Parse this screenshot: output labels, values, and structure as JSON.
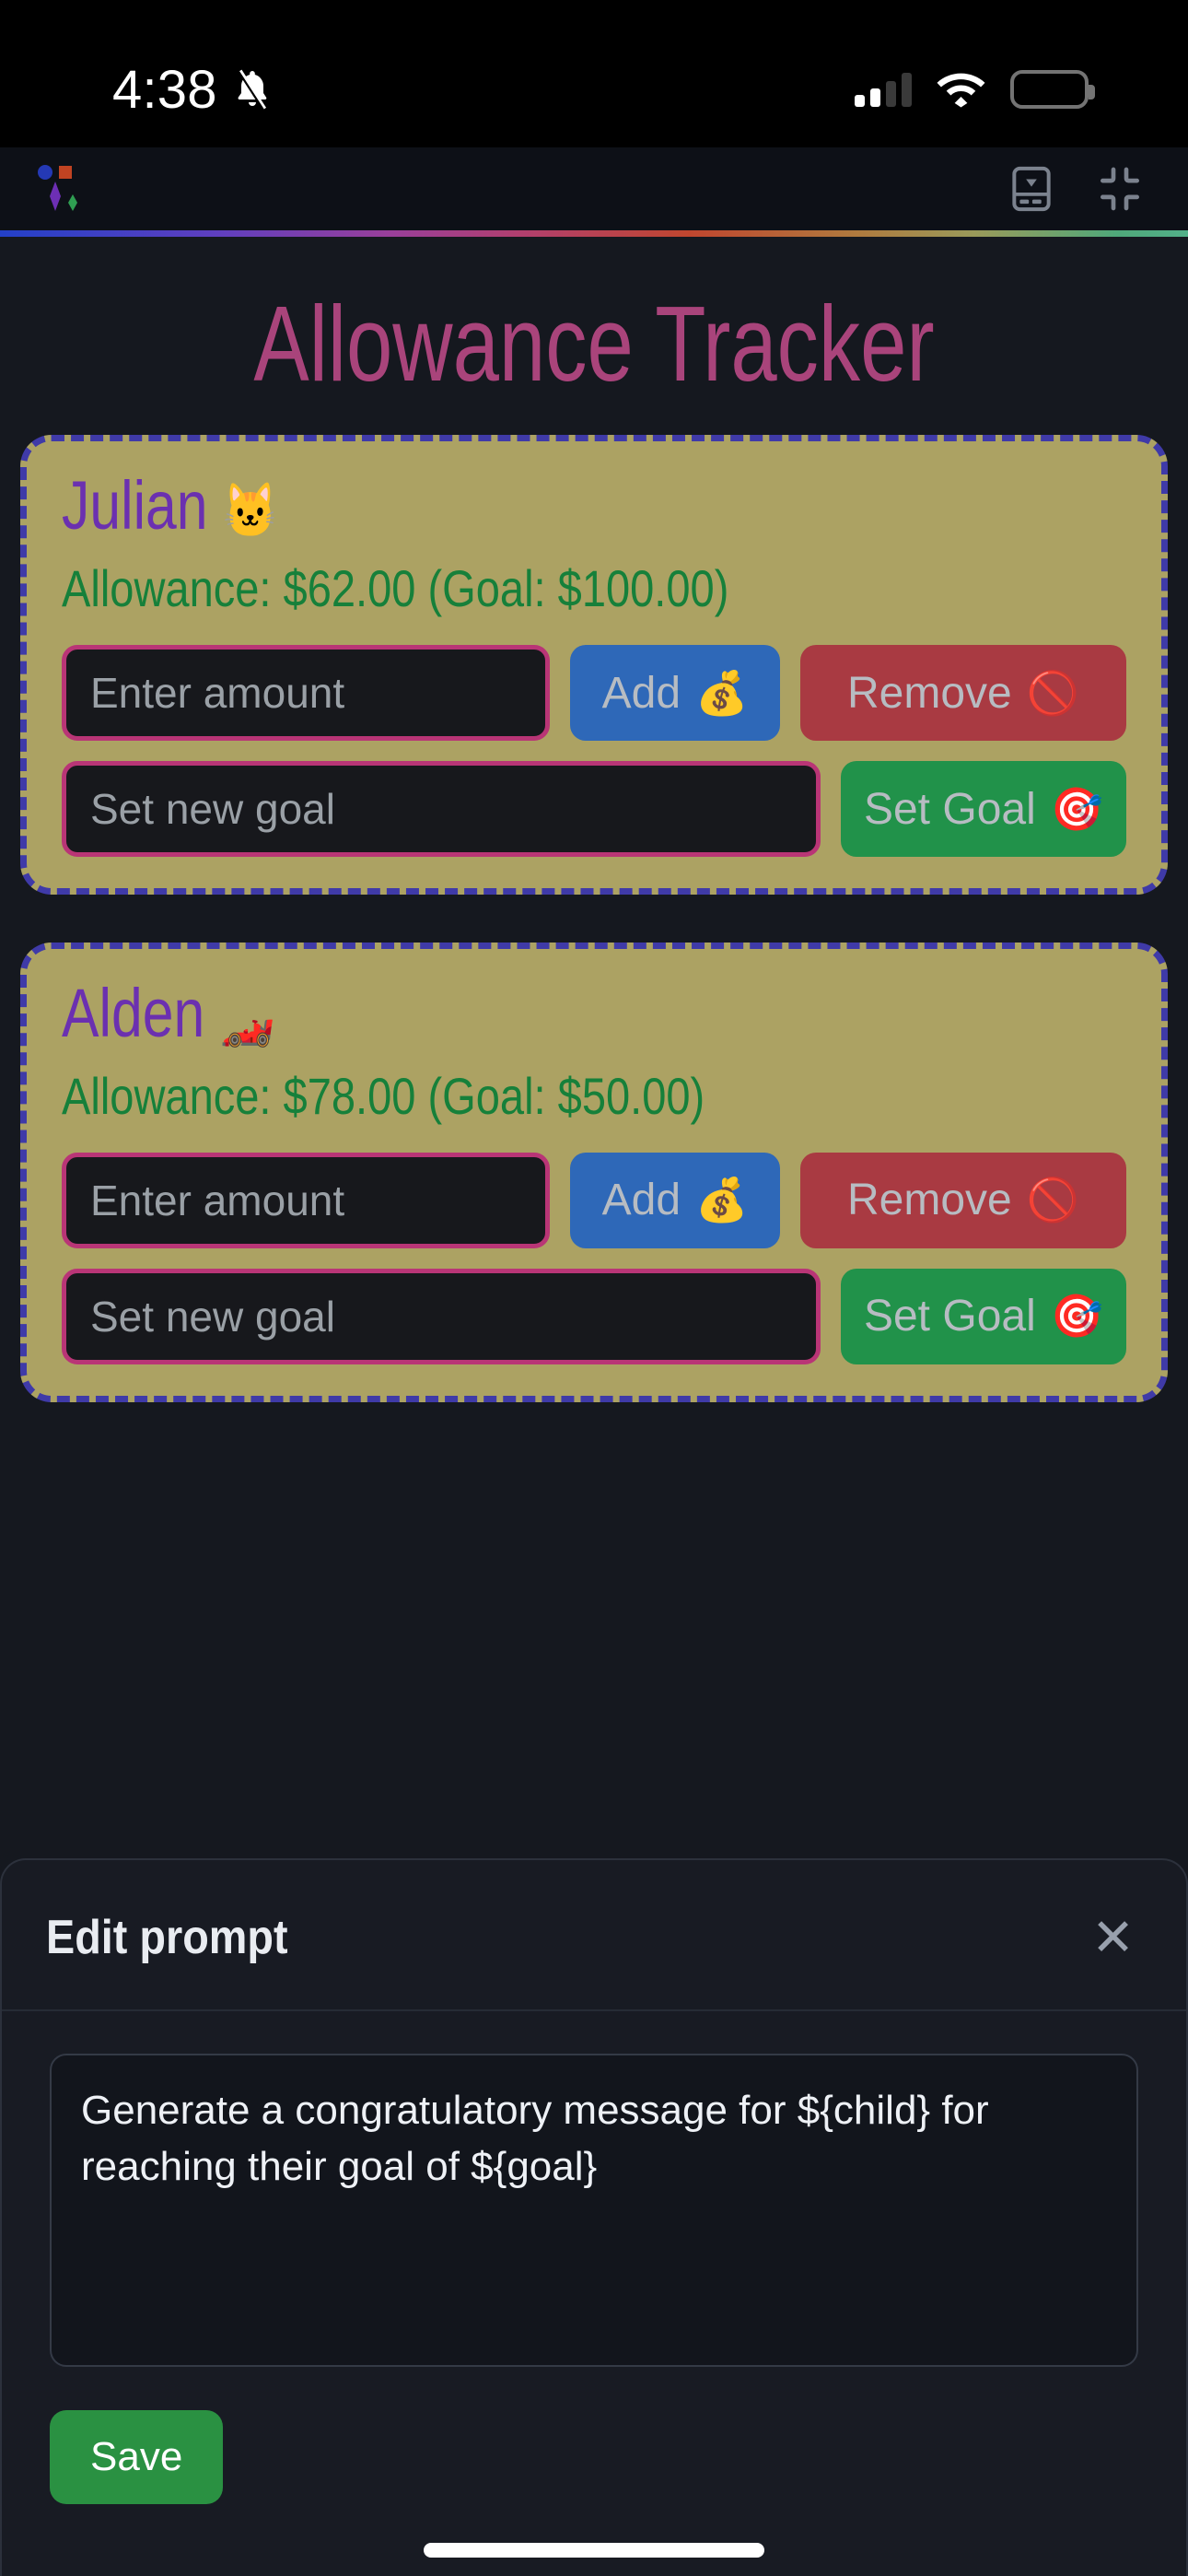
{
  "status_bar": {
    "time": "4:38",
    "silent_icon": "bell-off-icon",
    "signal_icon": "cellular-signal-icon",
    "wifi_icon": "wifi-icon",
    "battery_icon": "battery-icon"
  },
  "toolbar": {
    "logo_icon": "ai-sparkle-logo",
    "device_preview_icon": "form-input-icon",
    "collapse_icon": "collapse-inward-icon",
    "accent_gradient": "#2340c8 #9a3f9a #c0462f #52b089"
  },
  "app": {
    "title": "Allowance Tracker",
    "title_color": "#a9447b",
    "card_bg": "#aca263",
    "card_border": "#3f3aa8",
    "name_color": "#6b30b0",
    "allowance_color": "#16803a",
    "children": [
      {
        "name": "Julian",
        "emoji": "🐱",
        "allowance_text": "Allowance: $62.00 (Goal: $100.00)",
        "allowance": "$62.00",
        "goal": "$100.00",
        "amount_placeholder": "Enter amount",
        "goal_placeholder": "Set new goal",
        "amount_value": "",
        "goal_value": "",
        "add_label": "Add",
        "add_emoji": "💰",
        "remove_label": "Remove",
        "remove_emoji": "🚫",
        "set_goal_label": "Set Goal",
        "set_goal_emoji": "🎯"
      },
      {
        "name": "Alden",
        "emoji": "🏎️",
        "allowance_text": "Allowance: $78.00 (Goal: $50.00)",
        "allowance": "$78.00",
        "goal": "$50.00",
        "amount_placeholder": "Enter amount",
        "goal_placeholder": "Set new goal",
        "amount_value": "",
        "goal_value": "",
        "add_label": "Add",
        "add_emoji": "💰",
        "remove_label": "Remove",
        "remove_emoji": "🚫",
        "set_goal_label": "Set Goal",
        "set_goal_emoji": "🎯"
      }
    ]
  },
  "edit_prompt_sheet": {
    "title": "Edit prompt",
    "close_label": "✕",
    "prompt_value": "Generate a congratulatory message for ${child} for reaching their goal of ${goal}",
    "save_label": "Save",
    "save_color": "#2a9142"
  }
}
